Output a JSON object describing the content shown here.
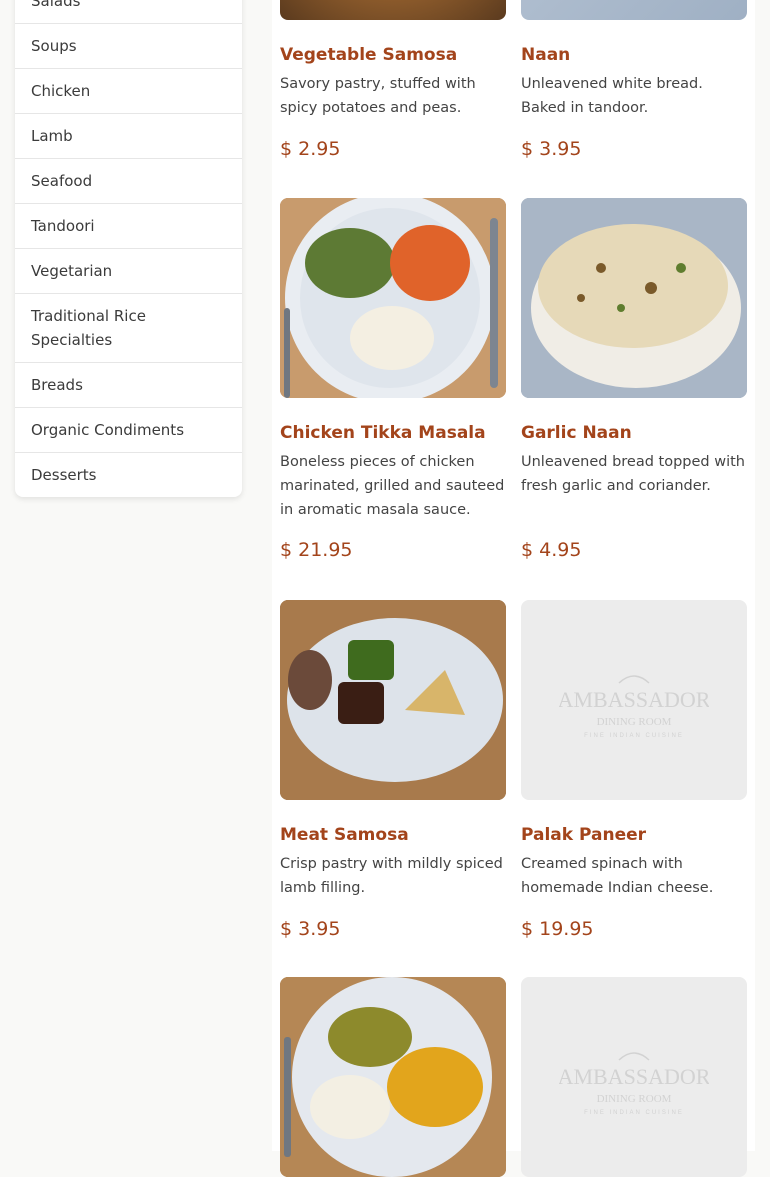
{
  "sidebar": {
    "items": [
      {
        "label": "Salads"
      },
      {
        "label": "Soups"
      },
      {
        "label": "Chicken"
      },
      {
        "label": "Lamb"
      },
      {
        "label": "Seafood"
      },
      {
        "label": "Tandoori"
      },
      {
        "label": "Vegetarian"
      },
      {
        "label": "Traditional Rice Specialties"
      },
      {
        "label": "Breads"
      },
      {
        "label": "Organic Condiments"
      },
      {
        "label": "Desserts"
      }
    ]
  },
  "menu": {
    "items": [
      {
        "name": "Vegetable Samosa",
        "description": "Savory pastry, stuffed with spicy potatoes and peas.",
        "price": "$ 2.95"
      },
      {
        "name": "Naan",
        "description": "Unleavened white bread. Baked in tandoor.",
        "price": "$ 3.95"
      },
      {
        "name": "Chicken Tikka Masala",
        "description": "Boneless pieces of chicken marinated, grilled and sauteed in aromatic masala sauce.",
        "price": "$ 21.95"
      },
      {
        "name": "Garlic Naan",
        "description": "Unleavened bread topped with fresh garlic and coriander.",
        "price": "$ 4.95"
      },
      {
        "name": "Meat Samosa",
        "description": "Crisp pastry with mildly spiced lamb filling.",
        "price": "$ 3.95"
      },
      {
        "name": "Palak Paneer",
        "description": "Creamed spinach with homemade Indian cheese.",
        "price": "$ 19.95"
      }
    ]
  },
  "placeholder_logo": {
    "line1": "AMBASSADOR",
    "line2": "DINING ROOM",
    "line3": "FINE INDIAN CUISINE"
  },
  "colors": {
    "accent": "#a3441b",
    "background": "#f9f9f7",
    "card_bg": "#ffffff"
  }
}
